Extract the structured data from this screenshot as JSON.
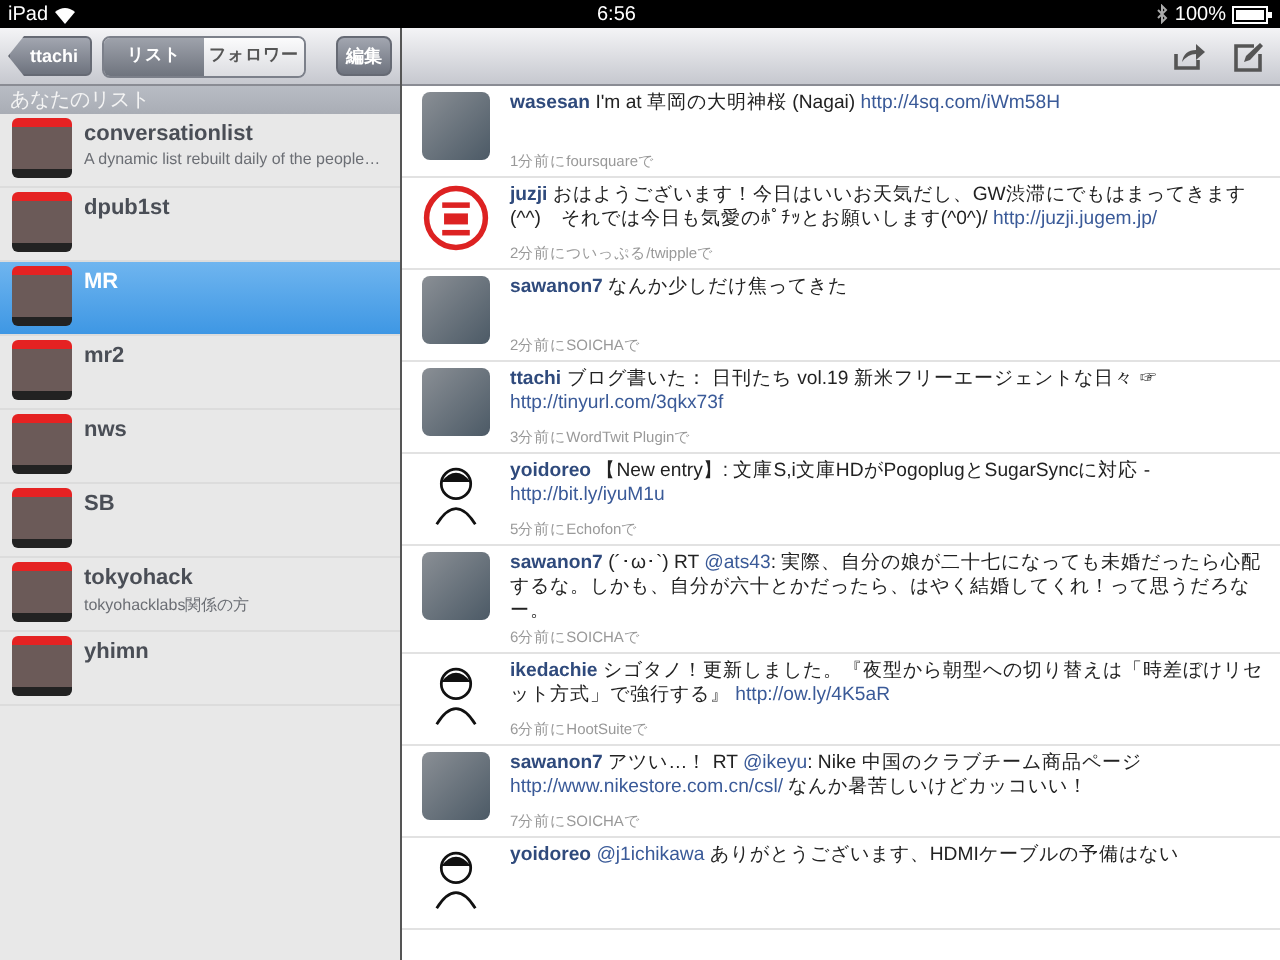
{
  "status_bar": {
    "device": "iPad",
    "time": "6:56",
    "battery": "100%"
  },
  "sidebar": {
    "back_button": "ttachi",
    "segments": [
      {
        "label": "リスト",
        "selected": true
      },
      {
        "label": "フォロワー",
        "selected": false
      }
    ],
    "edit_button": "編集",
    "section_title": "あなたのリスト",
    "lists": [
      {
        "name": "conversationlist",
        "description": "A dynamic list rebuilt daily of the people…",
        "selected": false
      },
      {
        "name": "dpub1st",
        "selected": false
      },
      {
        "name": "MR",
        "selected": true
      },
      {
        "name": "mr2",
        "selected": false
      },
      {
        "name": "nws",
        "selected": false
      },
      {
        "name": "SB",
        "selected": false
      },
      {
        "name": "tokyohack",
        "description": "tokyohacklabs関係の方",
        "selected": false
      },
      {
        "name": "yhimn",
        "selected": false
      }
    ]
  },
  "timeline": [
    {
      "kind": "photo",
      "user": "wasesan",
      "parts": [
        {
          "kind": "text",
          "text": "I'm at 草岡の大明神桜 (Nagai) "
        },
        {
          "kind": "link",
          "text": "http://4sq.com/iWm58H"
        }
      ],
      "meta": "1分前にfoursquareで"
    },
    {
      "kind": "stamp",
      "user": "juzji",
      "parts": [
        {
          "kind": "text",
          "text": "おはようございます！今日はいいお天気だし、GW渋滞にでもはまってきます(^^)　それでは今日も気愛のﾎﾟﾁｯとお願いします(^0^)/ "
        },
        {
          "kind": "link",
          "text": "http://juzji.jugem.jp/"
        }
      ],
      "meta": "2分前についっぷる/twippleで"
    },
    {
      "kind": "photo",
      "user": "sawanon7",
      "parts": [
        {
          "kind": "text",
          "text": "なんか少しだけ焦ってきた"
        }
      ],
      "meta": "2分前にSOICHAで"
    },
    {
      "kind": "photo",
      "user": "ttachi",
      "parts": [
        {
          "kind": "text",
          "text": "ブログ書いた： 日刊たち vol.19 新米フリーエージェントな日々 ☞ "
        },
        {
          "kind": "link",
          "text": "http://tinyurl.com/3qkx73f"
        }
      ],
      "meta": "3分前にWordTwit Pluginで"
    },
    {
      "kind": "cartoon",
      "user": "yoidoreo",
      "parts": [
        {
          "kind": "text",
          "text": "【New entry】: 文庫S,i文庫HDがPogoplugとSugarSyncに対応 - "
        },
        {
          "kind": "link",
          "text": "http://bit.ly/iyuM1u"
        }
      ],
      "meta": "5分前にEchofonで"
    },
    {
      "kind": "photo",
      "user": "sawanon7",
      "parts": [
        {
          "kind": "text",
          "text": "(´･ω･`) RT "
        },
        {
          "kind": "link",
          "text": "@ats43"
        },
        {
          "kind": "text",
          "text": ": 実際、自分の娘が二十七になっても未婚だったら心配するな。しかも、自分が六十とかだったら、はやく結婚してくれ！って思うだろなー。"
        }
      ],
      "meta": "6分前にSOICHAで"
    },
    {
      "kind": "cartoon",
      "user": "ikedachie",
      "parts": [
        {
          "kind": "text",
          "text": "シゴタノ！更新しました。『夜型から朝型への切り替えは「時差ぼけリセット方式」で強行する』 "
        },
        {
          "kind": "link",
          "text": "http://ow.ly/4K5aR"
        }
      ],
      "meta": "6分前にHootSuiteで"
    },
    {
      "kind": "photo",
      "user": "sawanon7",
      "parts": [
        {
          "kind": "text",
          "text": "アツい…！ RT "
        },
        {
          "kind": "link",
          "text": "@ikeyu"
        },
        {
          "kind": "text",
          "text": ": Nike 中国のクラブチーム商品ページ "
        },
        {
          "kind": "link",
          "text": "http://www.nikestore.com.cn/csl/"
        },
        {
          "kind": "text",
          "text": " なんか暑苦しいけどカッコいい！"
        }
      ],
      "meta": "7分前にSOICHAで"
    },
    {
      "kind": "cartoon",
      "user": "yoidoreo",
      "parts": [
        {
          "kind": "link",
          "text": "@j1ichikawa"
        },
        {
          "kind": "text",
          "text": " ありがとうございます、HDMIケーブルの予備はない"
        }
      ]
    }
  ]
}
